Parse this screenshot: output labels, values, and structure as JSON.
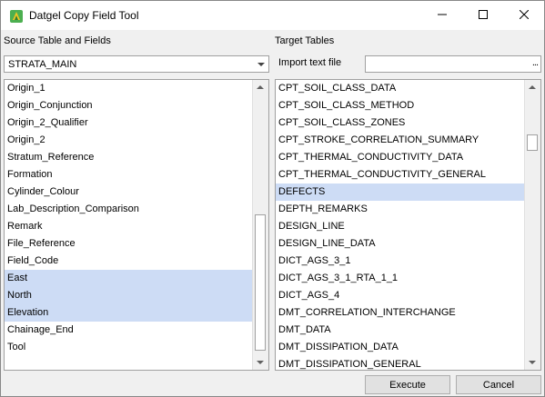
{
  "window": {
    "title": "Datgel Copy Field Tool"
  },
  "source": {
    "label": "Source Table and Fields",
    "table_value": "STRATA_MAIN",
    "fields": [
      {
        "label": "Origin_1",
        "selected": false
      },
      {
        "label": "Origin_Conjunction",
        "selected": false
      },
      {
        "label": "Origin_2_Qualifier",
        "selected": false
      },
      {
        "label": "Origin_2",
        "selected": false
      },
      {
        "label": "Stratum_Reference",
        "selected": false
      },
      {
        "label": "Formation",
        "selected": false
      },
      {
        "label": "Cylinder_Colour",
        "selected": false
      },
      {
        "label": "Lab_Description_Comparison",
        "selected": false
      },
      {
        "label": "Remark",
        "selected": false
      },
      {
        "label": "File_Reference",
        "selected": false
      },
      {
        "label": "Field_Code",
        "selected": false
      },
      {
        "label": "East",
        "selected": true
      },
      {
        "label": "North",
        "selected": true
      },
      {
        "label": "Elevation",
        "selected": true
      },
      {
        "label": "Chainage_End",
        "selected": false
      },
      {
        "label": "Tool",
        "selected": false
      }
    ]
  },
  "target": {
    "label": "Target Tables",
    "import_label": "Import text file",
    "import_value": "",
    "browse_label": "...",
    "tables": [
      {
        "label": "CPT_SOIL_CLASS_DATA",
        "selected": false
      },
      {
        "label": "CPT_SOIL_CLASS_METHOD",
        "selected": false
      },
      {
        "label": "CPT_SOIL_CLASS_ZONES",
        "selected": false
      },
      {
        "label": "CPT_STROKE_CORRELATION_SUMMARY",
        "selected": false
      },
      {
        "label": "CPT_THERMAL_CONDUCTIVITY_DATA",
        "selected": false
      },
      {
        "label": "CPT_THERMAL_CONDUCTIVITY_GENERAL",
        "selected": false
      },
      {
        "label": "DEFECTS",
        "selected": true
      },
      {
        "label": "DEPTH_REMARKS",
        "selected": false
      },
      {
        "label": "DESIGN_LINE",
        "selected": false
      },
      {
        "label": "DESIGN_LINE_DATA",
        "selected": false
      },
      {
        "label": "DICT_AGS_3_1",
        "selected": false
      },
      {
        "label": "DICT_AGS_3_1_RTA_1_1",
        "selected": false
      },
      {
        "label": "DICT_AGS_4",
        "selected": false
      },
      {
        "label": "DMT_CORRELATION_INTERCHANGE",
        "selected": false
      },
      {
        "label": "DMT_DATA",
        "selected": false
      },
      {
        "label": "DMT_DISSIPATION_DATA",
        "selected": false
      },
      {
        "label": "DMT_DISSIPATION_GENERAL",
        "selected": false
      }
    ]
  },
  "buttons": {
    "execute": "Execute",
    "cancel": "Cancel"
  },
  "colors": {
    "selection": "#cddcf5",
    "window_bg": "#f0f0f0"
  },
  "icons": {
    "app": "datgel-app-icon",
    "minimize": "minimize-icon",
    "maximize": "maximize-icon",
    "close": "close-icon"
  }
}
